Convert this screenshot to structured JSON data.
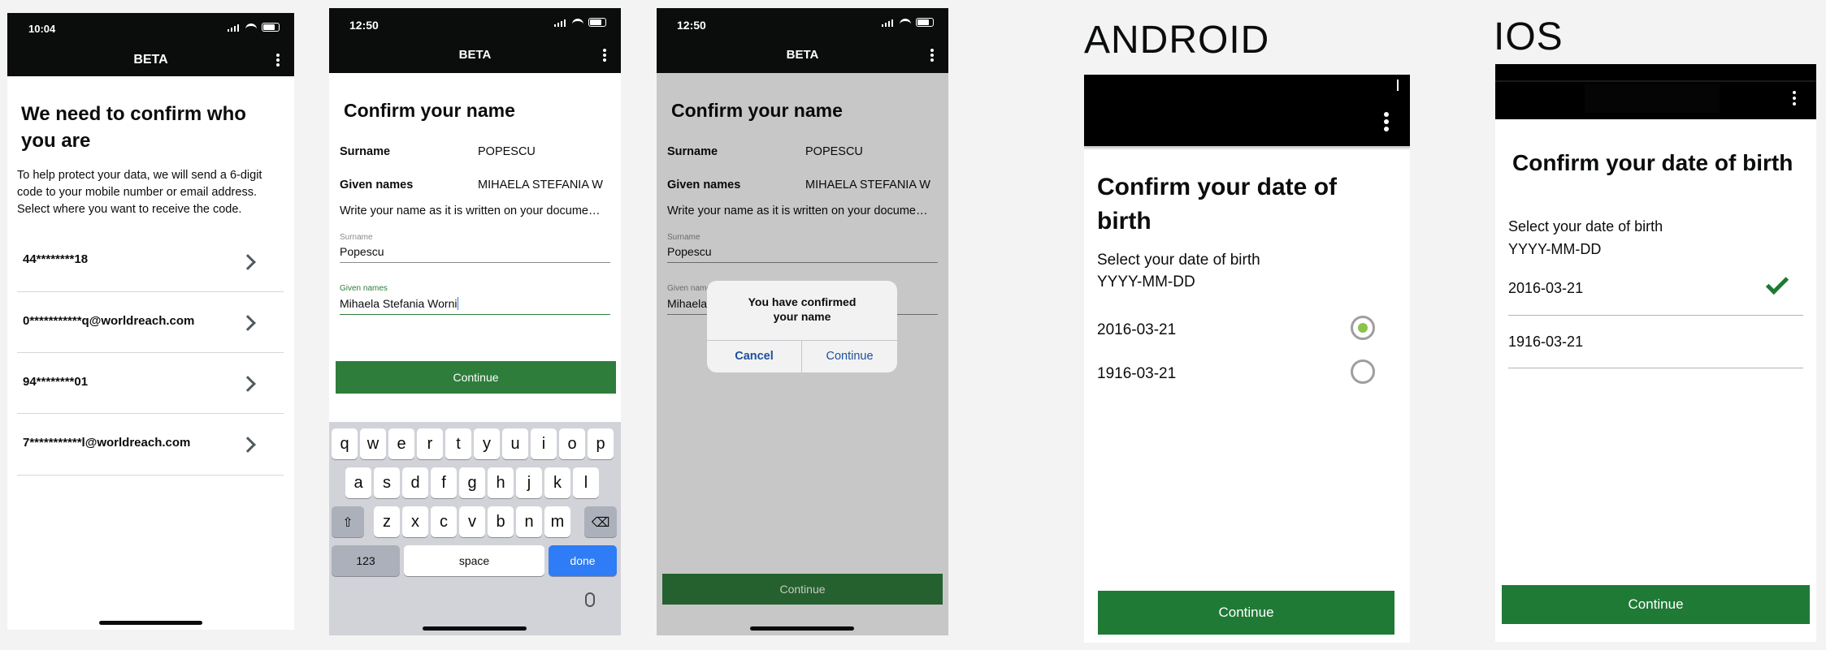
{
  "phone1": {
    "time": "10:04",
    "app_title": "BETA",
    "heading": "We need to confirm who you are",
    "intro": "To help protect your data, we will send a 6-digit code to your mobile number or email address. Select where you want to receive the code.",
    "options": [
      "44********18",
      "0***********q@worldreach.com",
      "94********01",
      "7***********l@worldreach.com"
    ]
  },
  "phone2": {
    "time": "12:50",
    "app_title": "BETA",
    "heading": "Confirm your name",
    "surname_label": "Surname",
    "surname_value": "POPESCU",
    "given_label": "Given names",
    "given_value": "MIHAELA STEFANIA W",
    "hint": "Write your name as it is written on your docume…",
    "surname_field_label": "Surname",
    "surname_field_value": "Popescu",
    "given_field_label": "Given names",
    "given_field_value": "Mihaela Stefania Worni",
    "continue": "Continue",
    "keyboard": {
      "row1": [
        "q",
        "w",
        "e",
        "r",
        "t",
        "y",
        "u",
        "i",
        "o",
        "p"
      ],
      "row2": [
        "a",
        "s",
        "d",
        "f",
        "g",
        "h",
        "j",
        "k",
        "l"
      ],
      "row3": [
        "z",
        "x",
        "c",
        "v",
        "b",
        "n",
        "m"
      ],
      "numbers": "123",
      "space": "space",
      "done": "done"
    }
  },
  "phone3": {
    "time": "12:50",
    "app_title": "BETA",
    "heading": "Confirm your name",
    "surname_label": "Surname",
    "surname_value": "POPESCU",
    "given_label": "Given names",
    "given_value": "MIHAELA STEFANIA W",
    "hint": "Write your name as it is written on your docume…",
    "surname_field_label": "Surname",
    "surname_field_value": "Popescu",
    "given_field_label": "Given name",
    "given_field_value": "Mihaela",
    "dialog_message": "You have confirmed your name",
    "dialog_cancel": "Cancel",
    "dialog_continue": "Continue",
    "continue": "Continue"
  },
  "android": {
    "label": "ANDROID",
    "heading": "Confirm your date of birth",
    "select_label": "Select your date of birth",
    "format": "YYYY-MM-DD",
    "options": [
      "2016-03-21",
      "1916-03-21"
    ],
    "selected_index": 0,
    "continue": "Continue"
  },
  "ios": {
    "label": "IOS",
    "heading": "Confirm your date of birth",
    "select_label": "Select your date of birth",
    "format": "YYYY-MM-DD",
    "options": [
      "2016-03-21",
      "1916-03-21"
    ],
    "selected_index": 0,
    "continue": "Continue"
  }
}
